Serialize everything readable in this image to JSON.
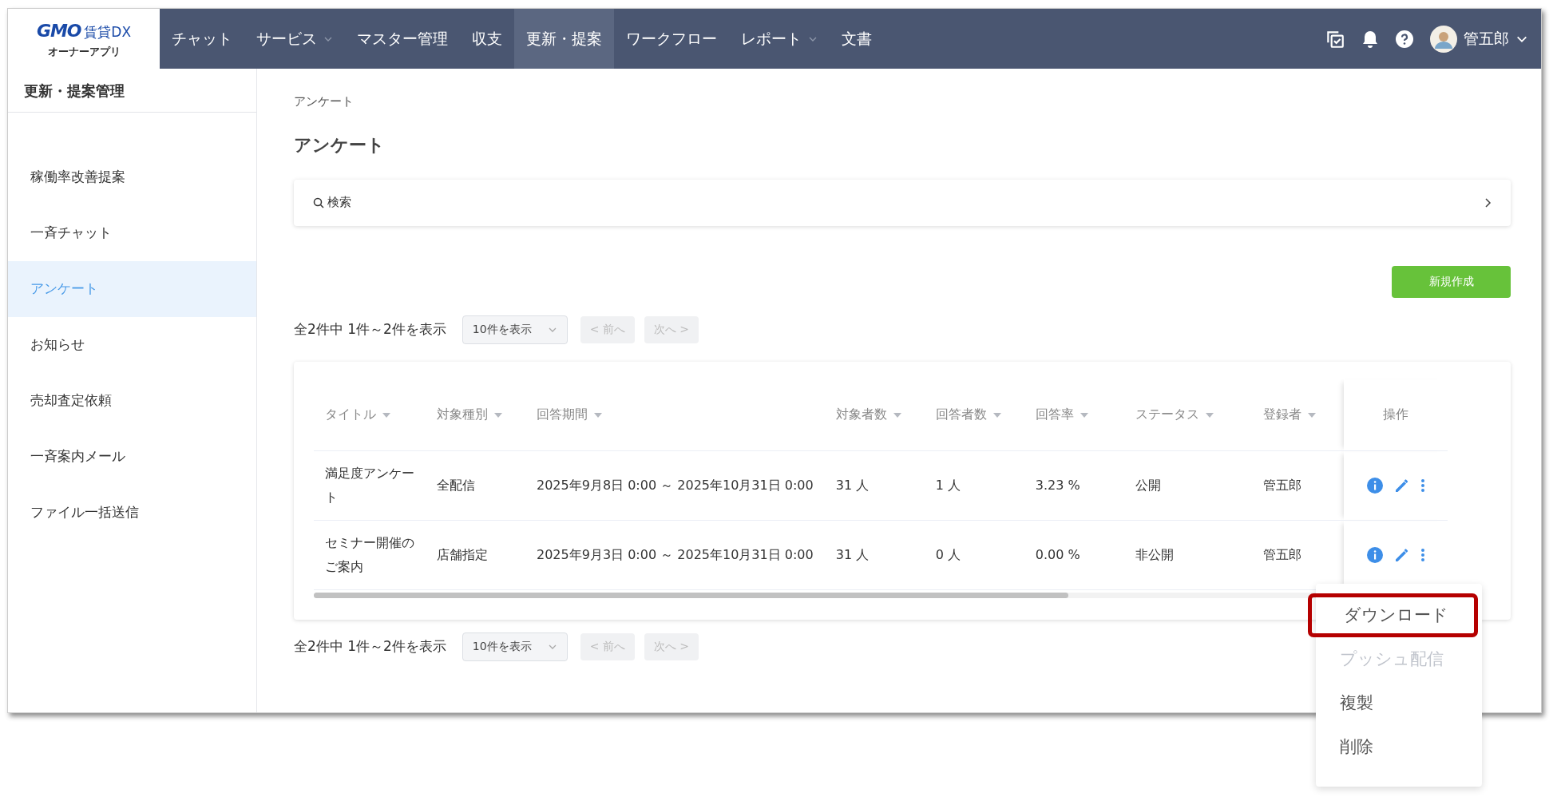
{
  "logo": {
    "brand": "GMO",
    "product": "賃貸DX",
    "subtitle": "オーナーアプリ"
  },
  "nav": [
    {
      "label": "チャット",
      "selected": false,
      "dropdown": false
    },
    {
      "label": "サービス",
      "selected": false,
      "dropdown": true
    },
    {
      "label": "マスター管理",
      "selected": false,
      "dropdown": false
    },
    {
      "label": "収支",
      "selected": false,
      "dropdown": false
    },
    {
      "label": "更新・提案",
      "selected": true,
      "dropdown": false
    },
    {
      "label": "ワークフロー",
      "selected": false,
      "dropdown": false
    },
    {
      "label": "レポート",
      "selected": false,
      "dropdown": true
    },
    {
      "label": "文書",
      "selected": false,
      "dropdown": false
    }
  ],
  "user": {
    "name": "管五郎"
  },
  "sidebar": {
    "title": "更新・提案管理",
    "items": [
      {
        "label": "稼働率改善提案",
        "selected": false
      },
      {
        "label": "一斉チャット",
        "selected": false
      },
      {
        "label": "アンケート",
        "selected": true
      },
      {
        "label": "お知らせ",
        "selected": false
      },
      {
        "label": "売却査定依頼",
        "selected": false
      },
      {
        "label": "一斉案内メール",
        "selected": false
      },
      {
        "label": "ファイル一括送信",
        "selected": false
      }
    ]
  },
  "breadcrumb": [
    "アンケート"
  ],
  "page_title": "アンケート",
  "search": {
    "label": "検索"
  },
  "new_button": "新規作成",
  "pagination_top": {
    "summary": "全2件中 1件～2件を表示",
    "page_size": "10件を表示",
    "prev": {
      "label": "< 前へ",
      "disabled": true
    },
    "next": {
      "label": "次へ >",
      "disabled": true
    }
  },
  "table": {
    "columns": [
      {
        "label": "タイトル",
        "sortable": true
      },
      {
        "label": "対象種別",
        "sortable": true
      },
      {
        "label": "回答期間",
        "sortable": true
      },
      {
        "label": "対象者数",
        "sortable": true
      },
      {
        "label": "回答者数",
        "sortable": true
      },
      {
        "label": "回答率",
        "sortable": true
      },
      {
        "label": "ステータス",
        "sortable": true
      },
      {
        "label": "登録者",
        "sortable": true
      },
      {
        "label": "操作",
        "sortable": false
      }
    ],
    "rows": [
      {
        "cells": [
          "満足度アンケート",
          "全配信",
          "2025年9月8日 0:00 ～ 2025年10月31日 0:00",
          "31 人",
          "1 人",
          "3.23 %",
          "公開",
          "管五郎"
        ]
      },
      {
        "cells": [
          "セミナー開催のご案内",
          "店舗指定",
          "2025年9月3日 0:00 ～ 2025年10月31日 0:00",
          "31 人",
          "0 人",
          "0.00 %",
          "非公開",
          "管五郎"
        ]
      }
    ]
  },
  "pagination_bottom": {
    "summary": "全2件中 1件～2件を表示",
    "page_size": "10件を表示",
    "prev": {
      "label": "< 前へ",
      "disabled": true
    },
    "next": {
      "label": "次へ >",
      "disabled": true
    }
  },
  "action_menu": {
    "items": [
      {
        "label": "ダウンロード",
        "disabled": false,
        "highlighted": true
      },
      {
        "label": "プッシュ配信",
        "disabled": true,
        "highlighted": false
      },
      {
        "label": "複製",
        "disabled": false,
        "highlighted": false
      },
      {
        "label": "削除",
        "disabled": false,
        "highlighted": false
      }
    ]
  }
}
